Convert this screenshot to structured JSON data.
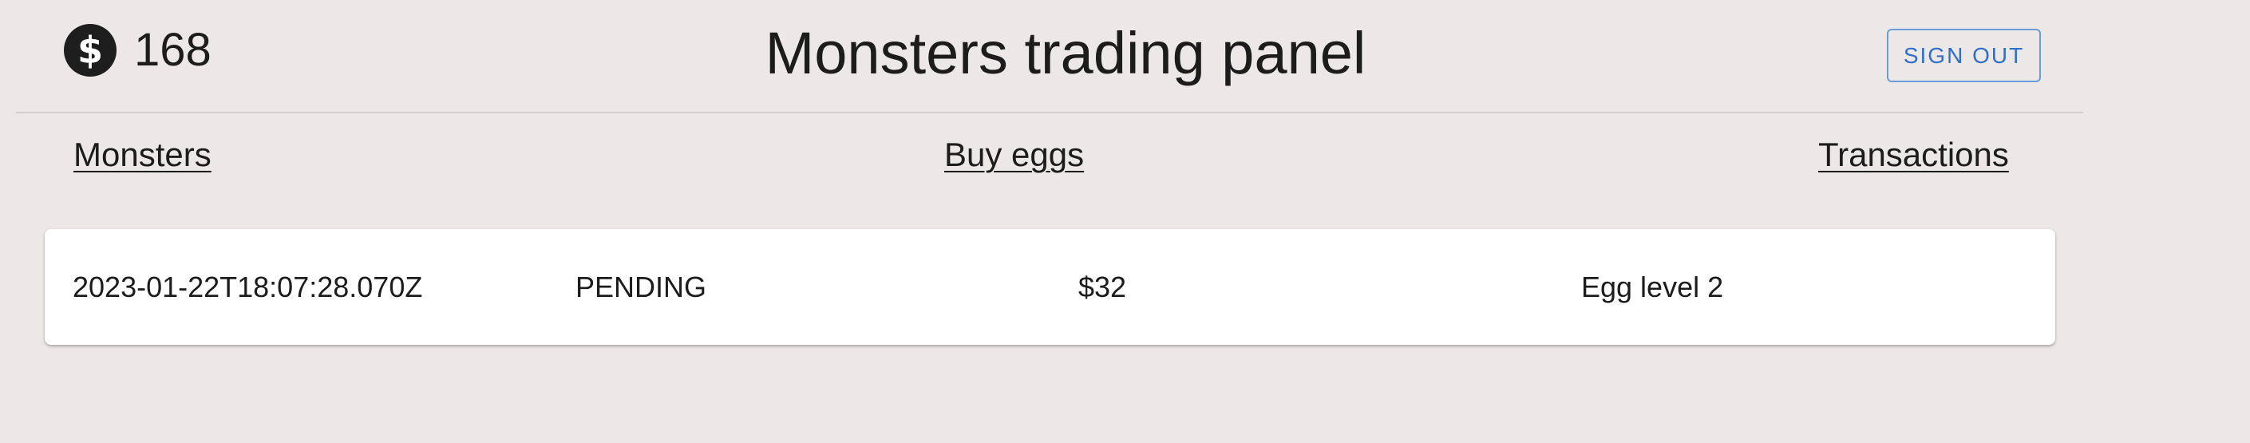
{
  "header": {
    "balance": "168",
    "balance_icon": "dollar-icon",
    "title": "Monsters trading panel",
    "sign_out_label": "SIGN OUT"
  },
  "nav": {
    "monsters": "Monsters",
    "buy_eggs": "Buy eggs",
    "transactions": "Transactions"
  },
  "transactions": [
    {
      "date": "2023-01-22T18:07:28.070Z",
      "status": "PENDING",
      "amount": "$32",
      "item": "Egg level 2"
    }
  ],
  "colors": {
    "background": "#ece8e7",
    "accent": "#2f6fc7",
    "card": "#ffffff"
  }
}
